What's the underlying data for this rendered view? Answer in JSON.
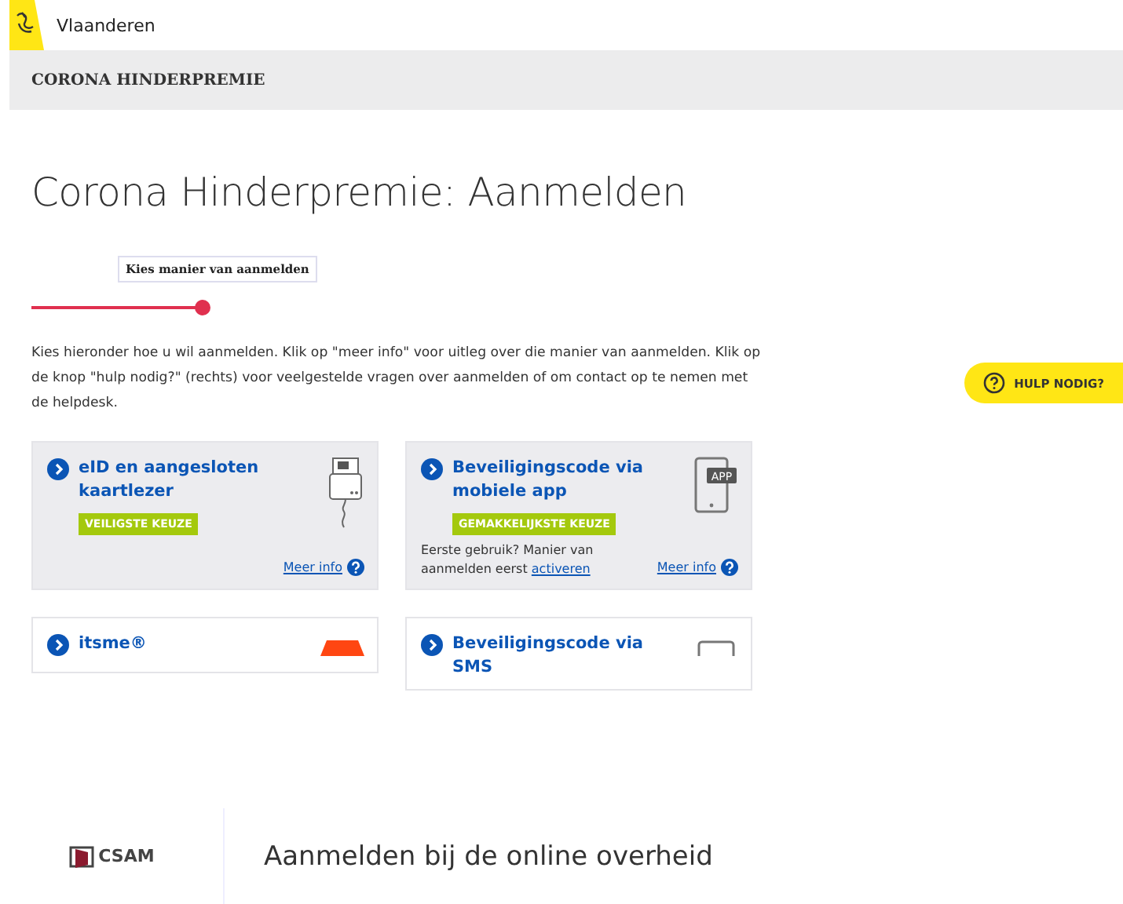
{
  "header": {
    "brand": "Vlaanderen"
  },
  "title_bar": {
    "title": "CORONA HINDERPREMIE"
  },
  "page_title": "Corona Hinderpremie: Aanmelden",
  "progress": {
    "step_label": "Kies manier van aanmelden"
  },
  "help_button": {
    "label": "HULP NODIG?"
  },
  "intro": "Kies hieronder hoe u wil aanmelden. Klik op \"meer info\" voor uitleg over die manier van aanmelden. Klik op de knop \"hulp nodig?\" (rechts) voor veelgestelde vragen over aanmelden of om contact op te nemen met de helpdesk.",
  "methods": [
    {
      "kind": "cardreader",
      "title": "eID en aangesloten kaartlezer",
      "tag": "VEILIGSTE KEUZE",
      "link": "Meer info"
    },
    {
      "kind": "app",
      "icon_label": "APP",
      "title": "Beveiligingscode via mobiele app",
      "tag": "GEMAKKELIJKSTE KEUZE",
      "note": "Eerste gebruik? Manier van aanmelden eerst",
      "note_link": "activeren",
      "link": "Meer info"
    },
    {
      "kind": "itsme",
      "title": "itsme®"
    },
    {
      "kind": "sms",
      "title": "Beveiligingscode via SMS"
    }
  ],
  "footer": {
    "logo": "CSAM",
    "text": "Aanmelden bij de online overheid"
  }
}
